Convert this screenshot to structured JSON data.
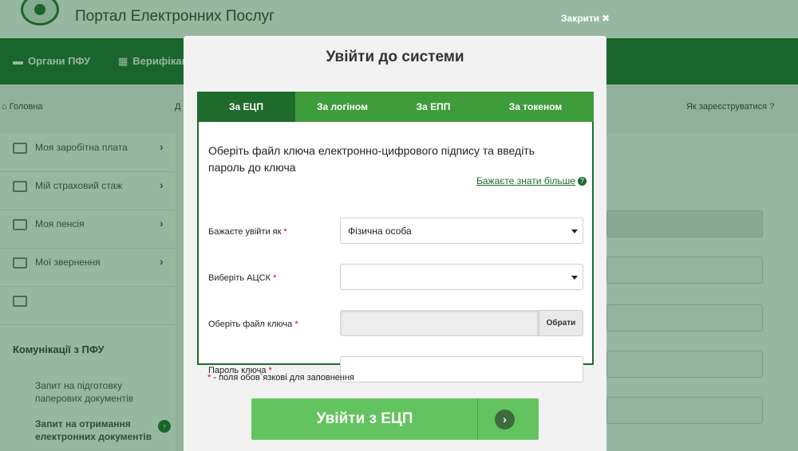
{
  "background": {
    "portal_title": "Портал Електронних Послуг",
    "nav": [
      {
        "label": "Органи ПФУ",
        "icon": "ukraine-flag-icon"
      },
      {
        "label": "Верифікац",
        "icon": "grid-icon"
      }
    ],
    "breadcrumb": {
      "home": "Головна",
      "partial": "Д"
    },
    "register_link": "Як зареєструватися",
    "sidebar": {
      "items": [
        {
          "label": "Моя заробітна плата",
          "icon": "wallet-icon"
        },
        {
          "label": "Мій страховий стаж",
          "icon": "calendar-icon"
        },
        {
          "label": "Моя пенсія",
          "icon": "folder-icon"
        },
        {
          "label": "Мої звернення",
          "icon": "envelope-icon"
        },
        {
          "label": "",
          "icon": "mail-icon"
        }
      ],
      "section_heading": "Комунікації з ПФУ",
      "comm_items": [
        {
          "label": "Запит на підготовку паперових документів",
          "icon": "document-icon"
        },
        {
          "label": "Запит на отримання електронних документів",
          "icon": "document-icon"
        }
      ]
    }
  },
  "close_label": "Закрити",
  "modal": {
    "title": "Увійти до системи",
    "tabs": [
      {
        "label": "За ЕЦП",
        "active": true
      },
      {
        "label": "За логіном",
        "active": false
      },
      {
        "label": "За ЕПП",
        "active": false
      },
      {
        "label": "За токеном",
        "active": false
      }
    ],
    "intro": "Оберіть файл ключа електронно-цифрового підпису та введіть пароль до ключа",
    "learn_more": "Бажаєте знати більше",
    "form": {
      "login_as_label": "Бажаєте увійти як",
      "login_as_value": "Фізична особа",
      "acsk_label": "Виберіть АЦСК",
      "acsk_value": "",
      "key_file_label": "Оберіть файл ключа",
      "key_file_button": "Обрати",
      "password_label": "Пароль ключа",
      "password_value": "",
      "required_mark": "*"
    },
    "required_note": "- поля обов`язкові для заповнення",
    "submit_label": "Увійти з ЕЦП"
  },
  "colors": {
    "primary_dark": "#1e6b2c",
    "tab_bar": "#3f9c3b",
    "submit": "#63c45f",
    "required": "#d0021b"
  }
}
